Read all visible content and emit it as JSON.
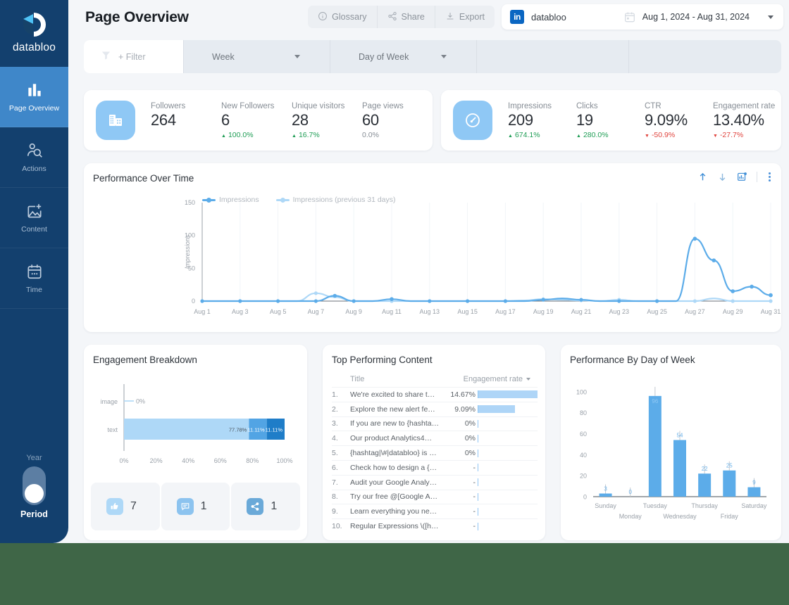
{
  "brand": {
    "name": "databloo"
  },
  "sidebar": {
    "items": [
      {
        "label": "Page Overview",
        "icon": "bar-chart-icon",
        "active": true
      },
      {
        "label": "Actions",
        "icon": "user-search-icon",
        "active": false
      },
      {
        "label": "Content",
        "icon": "image-add-icon",
        "active": false
      },
      {
        "label": "Time",
        "icon": "calendar-icon",
        "active": false
      }
    ],
    "toggle": {
      "top_label": "Year",
      "bottom_label": "Period",
      "selected": "Period"
    }
  },
  "header": {
    "title": "Page Overview",
    "actions": [
      {
        "label": "Glossary",
        "icon": "info-icon"
      },
      {
        "label": "Share",
        "icon": "share-icon"
      },
      {
        "label": "Export",
        "icon": "download-icon"
      }
    ],
    "account": {
      "network": "in",
      "name": "databloo"
    },
    "date_range": "Aug 1, 2024 - Aug 31, 2024"
  },
  "filter_bar": {
    "add_filter_label": "+ Filter",
    "segments": [
      {
        "label": "Week"
      },
      {
        "label": "Day of Week"
      },
      {
        "label": ""
      },
      {
        "label": ""
      }
    ]
  },
  "kpi_cards": [
    {
      "icon": "company-building-icon",
      "metrics": [
        {
          "name": "Followers",
          "value": "264",
          "delta": "",
          "direction": "none"
        },
        {
          "name": "New Followers",
          "value": "6",
          "delta": "100.0%",
          "direction": "up"
        },
        {
          "name": "Unique visitors",
          "value": "28",
          "delta": "16.7%",
          "direction": "up"
        },
        {
          "name": "Page views",
          "value": "60",
          "delta": "0.0%",
          "direction": "flat"
        }
      ]
    },
    {
      "icon": "speedometer-icon",
      "metrics": [
        {
          "name": "Impressions",
          "value": "209",
          "delta": "674.1%",
          "direction": "up"
        },
        {
          "name": "Clicks",
          "value": "19",
          "delta": "280.0%",
          "direction": "up"
        },
        {
          "name": "CTR",
          "value": "9.09%",
          "delta": "-50.9%",
          "direction": "down"
        },
        {
          "name": "Engagement rate",
          "value": "13.40%",
          "delta": "-27.7%",
          "direction": "down"
        }
      ]
    }
  ],
  "performance_over_time": {
    "title": "Performance Over Time",
    "tools": [
      "arrow-up-icon",
      "arrow-down-icon",
      "chart-export-icon",
      "kebab-menu-icon"
    ]
  },
  "engagement_breakdown": {
    "title": "Engagement Breakdown"
  },
  "top_performing_content": {
    "title": "Top Performing Content",
    "columns": [
      "Title",
      "Engagement rate"
    ],
    "rows": [
      {
        "idx": "1.",
        "title": "We're excited to share t…",
        "rate": "14.67%",
        "bar": 100
      },
      {
        "idx": "2.",
        "title": "Explore the new alert fe…",
        "rate": "9.09%",
        "bar": 62
      },
      {
        "idx": "3.",
        "title": "If you are new to {hashta…",
        "rate": "0%",
        "bar": 0
      },
      {
        "idx": "4.",
        "title": "Our product Analytics4…",
        "rate": "0%",
        "bar": 0
      },
      {
        "idx": "5.",
        "title": "{hashtag|\\#|databloo} is …",
        "rate": "0%",
        "bar": 0
      },
      {
        "idx": "6.",
        "title": "Check how to design a {…",
        "rate": "-",
        "bar": 0
      },
      {
        "idx": "7.",
        "title": "Audit your Google Analy…",
        "rate": "-",
        "bar": 0
      },
      {
        "idx": "8.",
        "title": "Try our free @[Google A…",
        "rate": "-",
        "bar": 0
      },
      {
        "idx": "9.",
        "title": "Learn everything you ne…",
        "rate": "-",
        "bar": 0
      },
      {
        "idx": "10.",
        "title": "Regular Expressions \\([h…",
        "rate": "-",
        "bar": 0
      }
    ]
  },
  "engagement_tiles": [
    {
      "icon": "thumbs-up-icon",
      "value": "7",
      "color": "#aed8f7"
    },
    {
      "icon": "comment-icon",
      "value": "1",
      "color": "#8cc3ef"
    },
    {
      "icon": "share-nodes-icon",
      "value": "1",
      "color": "#6aa9d8"
    }
  ],
  "performance_by_day": {
    "title": "Performance By Day of Week"
  },
  "colors": {
    "sidebar": "#13406e",
    "sidebar_active": "#3f87c9",
    "accent": "#5cace9",
    "accent_light": "#aed8f7",
    "accent_dark": "#1f7dc8",
    "positive": "#1f9d55",
    "negative": "#e0443e",
    "page_bg": "#f4f6f9",
    "outer_bg": "#3f6647"
  },
  "chart_data": [
    {
      "type": "line",
      "title": "Performance Over Time",
      "xlabel": "",
      "ylabel": "Impressions",
      "ylim": [
        0,
        150
      ],
      "yticks": [
        0,
        50,
        100,
        150
      ],
      "grid": true,
      "legend_position": "top-left",
      "x": [
        "Aug 1",
        "Aug 2",
        "Aug 3",
        "Aug 4",
        "Aug 5",
        "Aug 6",
        "Aug 7",
        "Aug 8",
        "Aug 9",
        "Aug 10",
        "Aug 11",
        "Aug 12",
        "Aug 13",
        "Aug 14",
        "Aug 15",
        "Aug 16",
        "Aug 17",
        "Aug 18",
        "Aug 19",
        "Aug 20",
        "Aug 21",
        "Aug 22",
        "Aug 23",
        "Aug 24",
        "Aug 25",
        "Aug 26",
        "Aug 27",
        "Aug 28",
        "Aug 29",
        "Aug 30",
        "Aug 31"
      ],
      "xticks": [
        "Aug 1",
        "Aug 3",
        "Aug 5",
        "Aug 7",
        "Aug 9",
        "Aug 11",
        "Aug 13",
        "Aug 15",
        "Aug 17",
        "Aug 19",
        "Aug 21",
        "Aug 23",
        "Aug 25",
        "Aug 27",
        "Aug 29",
        "Aug 31"
      ],
      "series": [
        {
          "name": "Impressions",
          "color": "#5cace9",
          "values": [
            0,
            0,
            0,
            0,
            0,
            0,
            0,
            8,
            0,
            0,
            3,
            0,
            0,
            0,
            0,
            0,
            0,
            0,
            2,
            4,
            2,
            0,
            0,
            0,
            0,
            0,
            95,
            62,
            15,
            22,
            9
          ]
        },
        {
          "name": "Impressions (previous 31 days)",
          "color": "#aed8f7",
          "values": [
            0,
            0,
            0,
            0,
            0,
            0,
            12,
            6,
            0,
            0,
            0,
            0,
            0,
            0,
            0,
            0,
            0,
            1,
            3,
            2,
            1,
            0,
            2,
            0,
            0,
            0,
            0,
            4,
            0,
            0,
            0
          ]
        }
      ]
    },
    {
      "type": "bar",
      "orientation": "horizontal-stacked",
      "title": "Engagement Breakdown",
      "categories": [
        "image",
        "text"
      ],
      "xlabel": "",
      "ylabel": "",
      "xlim": [
        0,
        100
      ],
      "xticks": [
        "0%",
        "20%",
        "40%",
        "60%",
        "80%",
        "100%"
      ],
      "stacks": [
        {
          "category": "image",
          "segments": [
            {
              "label": "0%",
              "value": 0,
              "color": "#aed8f7"
            }
          ]
        },
        {
          "category": "text",
          "segments": [
            {
              "label": "77.78%",
              "value": 77.78,
              "color": "#aed8f7"
            },
            {
              "label": "11.11%",
              "value": 11.11,
              "color": "#52a4e4"
            },
            {
              "label": "11.11%",
              "value": 11.11,
              "color": "#1f7dc8"
            }
          ]
        }
      ]
    },
    {
      "type": "bar",
      "title": "Performance By Day of Week",
      "categories": [
        "Sunday",
        "Monday",
        "Tuesday",
        "Wednesday",
        "Thursday",
        "Friday",
        "Saturday"
      ],
      "values": [
        3,
        0,
        96,
        54,
        22,
        25,
        9
      ],
      "data_labels": [
        "3",
        "0",
        "96",
        "54",
        "22",
        "25",
        "9"
      ],
      "xlabel": "",
      "ylabel": "",
      "ylim": [
        0,
        110
      ],
      "yticks": [
        0,
        20,
        40,
        60,
        80,
        100
      ],
      "color": "#5cace9",
      "grid": false
    }
  ]
}
